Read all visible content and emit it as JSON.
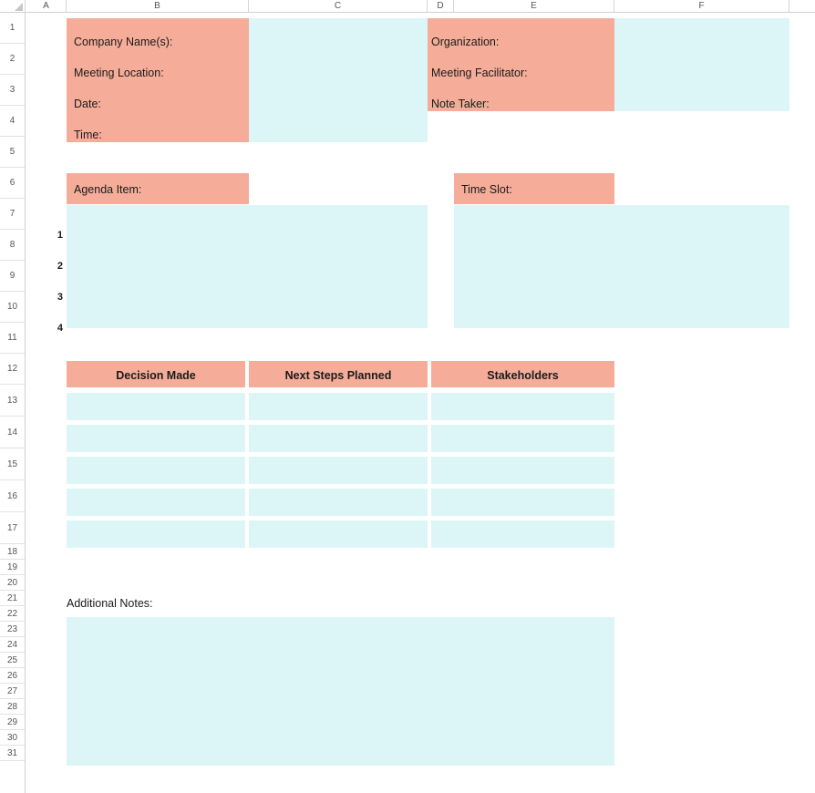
{
  "spreadsheet": {
    "columns": [
      "A",
      "B",
      "C",
      "D",
      "E",
      "F"
    ],
    "rows": [
      "1",
      "2",
      "3",
      "4",
      "5",
      "6",
      "7",
      "8",
      "9",
      "10",
      "11",
      "12",
      "13",
      "14",
      "15",
      "16",
      "17",
      "18",
      "19",
      "20",
      "21",
      "22",
      "23",
      "24",
      "25",
      "26",
      "27",
      "28",
      "29",
      "30",
      "31"
    ],
    "colors": {
      "header_fill": "#f5ad9a",
      "input_fill": "#dcf6f7",
      "grid_line": "#e2e2e2",
      "text": "#1a1a1a",
      "header_text": "#555555"
    }
  },
  "header_block_left": {
    "fields": [
      {
        "label": "Company Name(s):"
      },
      {
        "label": "Meeting Location:"
      },
      {
        "label": "Date:"
      },
      {
        "label": "Time:"
      }
    ]
  },
  "header_block_right": {
    "fields": [
      {
        "label": "Organization:"
      },
      {
        "label": "Meeting Facilitator:"
      },
      {
        "label": "Note Taker:"
      }
    ]
  },
  "agenda_section": {
    "agenda_label": "Agenda Item:",
    "timeslot_label": "Time Slot:",
    "item_numbers": [
      "1",
      "2",
      "3",
      "4"
    ]
  },
  "decision_table": {
    "headers": [
      "Decision Made",
      "Next Steps Planned",
      "Stakeholders"
    ],
    "row_count": 5
  },
  "notes_section": {
    "label": "Additional Notes:"
  }
}
